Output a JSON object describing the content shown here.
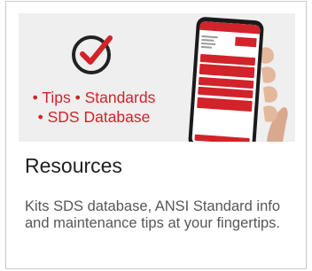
{
  "card": {
    "hero": {
      "bullet_lines": [
        "• Tips • Standards",
        "• SDS Database"
      ],
      "icon": "check-circle-icon",
      "accent_color": "#d2232a"
    },
    "title": "Resources",
    "description": "Kits SDS database, ANSI Standard info and maintenance tips at your fingertips."
  }
}
